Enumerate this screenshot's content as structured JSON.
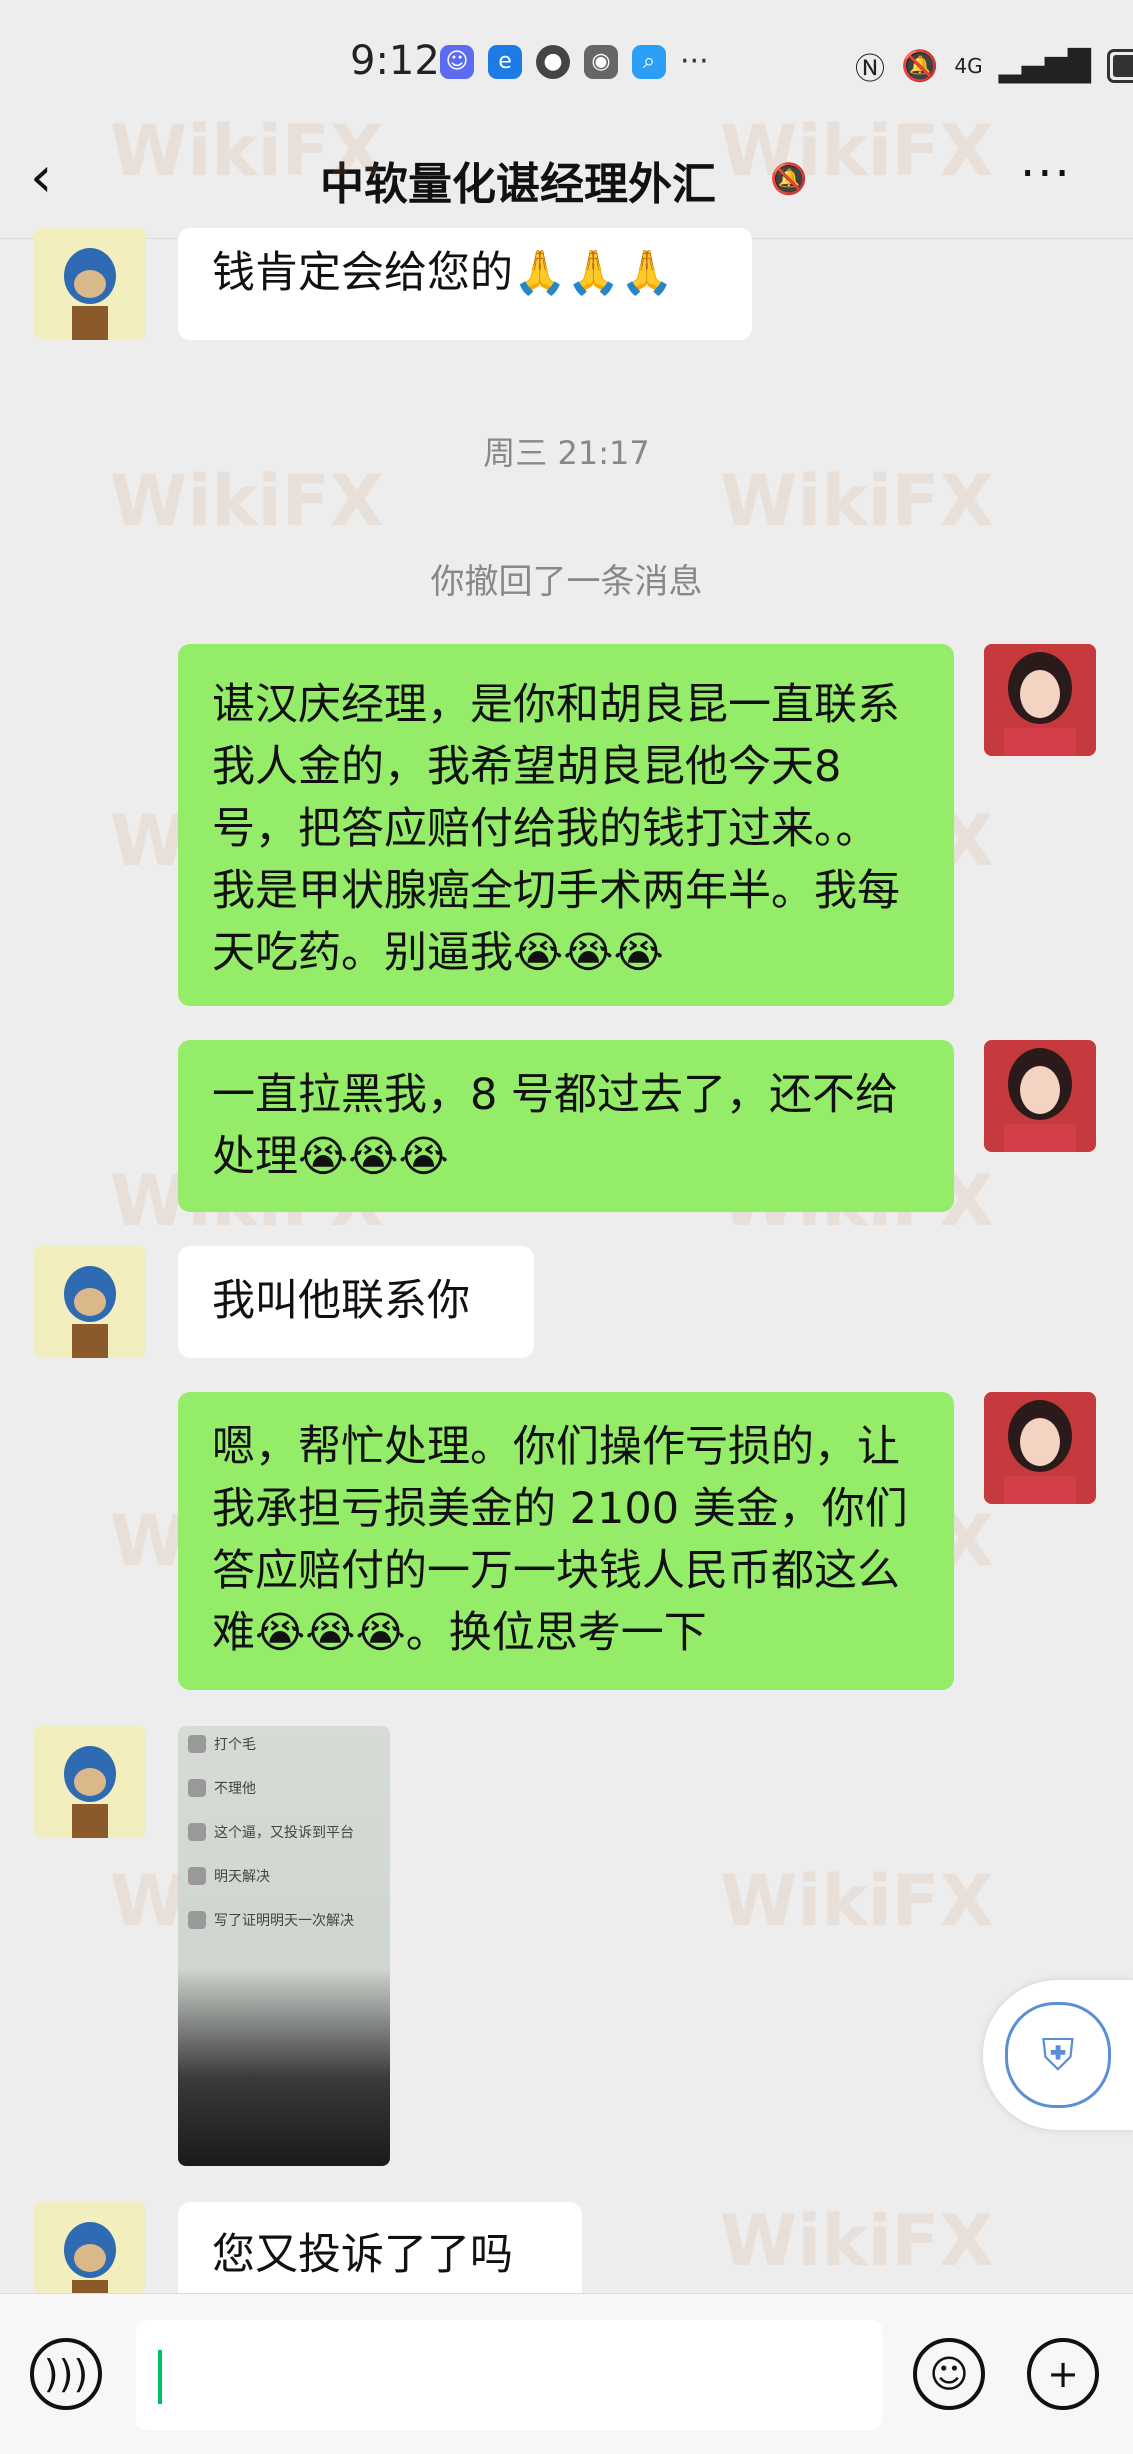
{
  "status_bar": {
    "time": "9:12",
    "more": "···",
    "network": "4G"
  },
  "nav": {
    "back_label": "‹",
    "title": "中软量化谌经理外汇",
    "more_label": "···"
  },
  "watermark_text": "WikiFX",
  "messages": [
    {
      "side": "in",
      "text": "钱肯定会给您的🙏🙏🙏"
    },
    {
      "type": "time",
      "text": "周三 21:17"
    },
    {
      "type": "system",
      "text": "你撤回了一条消息"
    },
    {
      "side": "out",
      "text": "谌汉庆经理，是你和胡良昆一直联系我人金的，我希望胡良昆他今天8 号，把答应赔付给我的钱打过来。。我是甲状腺癌全切手术两年半。我每天吃药。别逼我😭😭😭"
    },
    {
      "side": "out",
      "text": "一直拉黑我，8 号都过去了，还不给处理😭😭😭"
    },
    {
      "side": "in",
      "text": "我叫他联系你"
    },
    {
      "side": "out",
      "text": "嗯，帮忙处理。你们操作亏损的，让我承担亏损美金的 2100 美金，你们答应赔付的一万一块钱人民币都这么难😭😭😭。换位思考一下"
    },
    {
      "side": "in",
      "type": "image",
      "image_lines": [
        "打个毛",
        "不理他",
        "这个逼，又投诉到平台",
        "明天解决",
        "写了证明明天一次解决"
      ]
    },
    {
      "side": "in",
      "text": "您又投诉了了吗"
    }
  ],
  "colors": {
    "background": "#ededed",
    "bubble_out": "#95ec69",
    "bubble_in": "#ffffff",
    "caret": "#07c160"
  }
}
